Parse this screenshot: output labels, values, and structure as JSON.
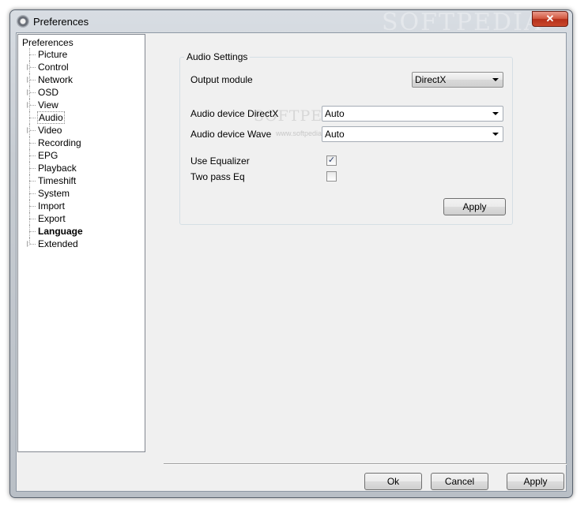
{
  "window": {
    "title": "Preferences",
    "close_label": "✕",
    "watermark": "SOFTPEDIA"
  },
  "tree": {
    "root": "Preferences",
    "items": [
      {
        "label": "Picture",
        "expandable": false
      },
      {
        "label": "Control",
        "expandable": true
      },
      {
        "label": "Network",
        "expandable": true
      },
      {
        "label": "OSD",
        "expandable": true
      },
      {
        "label": "View",
        "expandable": true
      },
      {
        "label": "Audio",
        "expandable": false,
        "selected": true
      },
      {
        "label": "Video",
        "expandable": true
      },
      {
        "label": "Recording",
        "expandable": false
      },
      {
        "label": "EPG",
        "expandable": false
      },
      {
        "label": "Playback",
        "expandable": false
      },
      {
        "label": "Timeshift",
        "expandable": false
      },
      {
        "label": "System",
        "expandable": false
      },
      {
        "label": "Import",
        "expandable": false
      },
      {
        "label": "Export",
        "expandable": false
      },
      {
        "label": "Language",
        "expandable": false,
        "bold": true
      },
      {
        "label": "Extended",
        "expandable": true
      }
    ]
  },
  "audio": {
    "group_title": "Audio Settings",
    "output_module_label": "Output module",
    "output_module_value": "DirectX",
    "device_directx_label": "Audio device DirectX",
    "device_directx_value": "Auto",
    "device_wave_label": "Audio device Wave",
    "device_wave_value": "Auto",
    "use_equalizer_label": "Use Equalizer",
    "use_equalizer_checked": true,
    "two_pass_eq_label": "Two pass Eq",
    "two_pass_eq_checked": false,
    "apply_label": "Apply",
    "watermark": "SOFTPEDIA",
    "watermark_url": "www.softpedia.com"
  },
  "footer": {
    "ok_label": "Ok",
    "cancel_label": "Cancel",
    "apply_label": "Apply"
  },
  "colors": {
    "close_red": "#c9472c",
    "frame": "#c7ccd2"
  }
}
